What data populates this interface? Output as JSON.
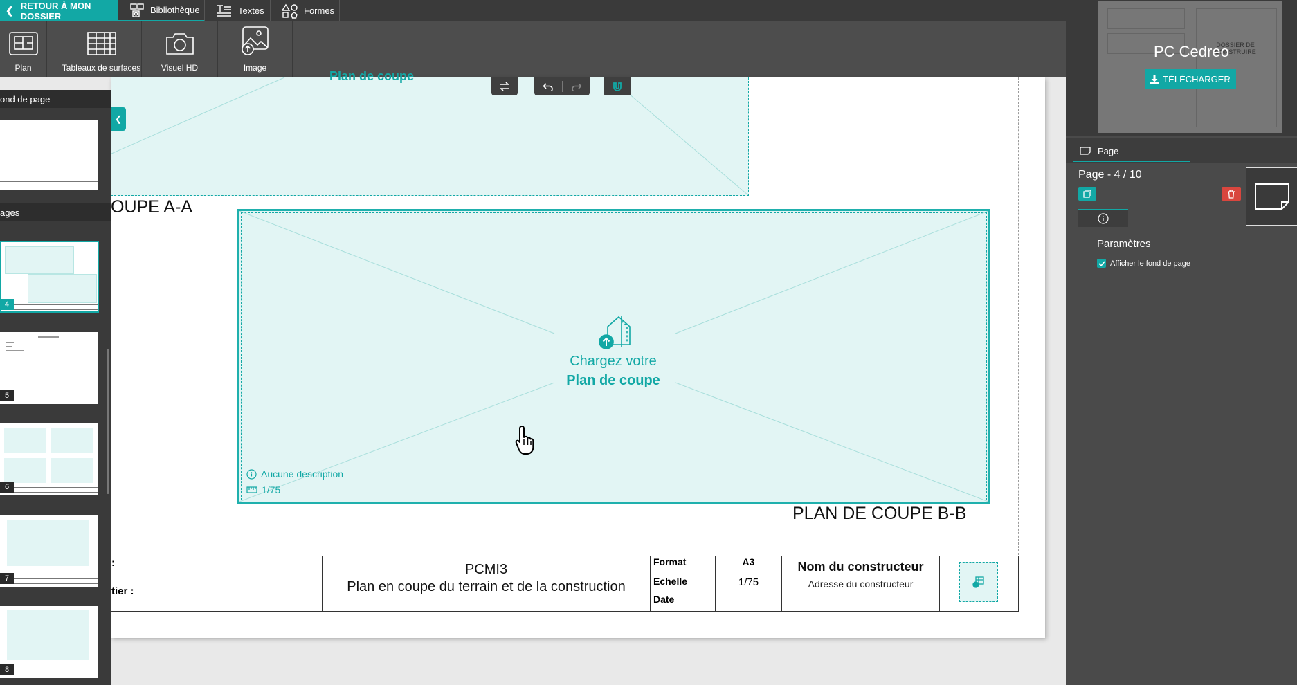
{
  "tabbar": {
    "back_label": "RETOUR À MON DOSSIER",
    "library_label": "Bibliothèque",
    "texts_label": "Textes",
    "shapes_label": "Formes"
  },
  "toolbar": {
    "plan_label": "Plan",
    "surfaces_label": "Tableaux de surfaces",
    "visual_label": "Visuel HD",
    "image_label": "Image"
  },
  "left_panel": {
    "background_header": "ond de page",
    "pages_header": "ages",
    "thumbnails": [
      {
        "number": "4",
        "active": true
      },
      {
        "number": "5",
        "active": false
      },
      {
        "number": "6",
        "active": false
      },
      {
        "number": "7",
        "active": false
      },
      {
        "number": "8",
        "active": false
      }
    ]
  },
  "canvas": {
    "top_placeholder_partial": "Plan de coupe",
    "section_a_label": "OUPE A-A",
    "section_b_label": "PLAN DE COUPE B-B",
    "placeholder": {
      "line1": "Chargez votre",
      "line2": "Plan de coupe",
      "description": "Aucune description",
      "scale": "1/75"
    },
    "title_block": {
      "left_row1": ":",
      "left_row2": "tier :",
      "code": "PCMI3",
      "subtitle": "Plan en coupe du terrain et de la construction",
      "format_label": "Format",
      "format_value": "A3",
      "scale_label": "Echelle",
      "scale_value": "1/75",
      "date_label": "Date",
      "date_value": "",
      "builder_name": "Nom du constructeur",
      "builder_address": "Adresse du constructeur"
    }
  },
  "right_panel": {
    "project_name": "PC Cedreo",
    "download_label": "TÉLÉCHARGER",
    "preview_text1": "DOSSIER DE",
    "preview_text2": "CONSTRUIRE",
    "page_tab_label": "Page",
    "page_counter": "Page - 4 / 10",
    "params_title": "Paramètres",
    "show_background_label": "Afficher le fond de page",
    "show_background_checked": true
  },
  "colors": {
    "accent": "#12a8a5",
    "danger": "#d9463e",
    "placeholder_fill": "#e2f5f4",
    "dark_bar": "#3a3a3a"
  }
}
